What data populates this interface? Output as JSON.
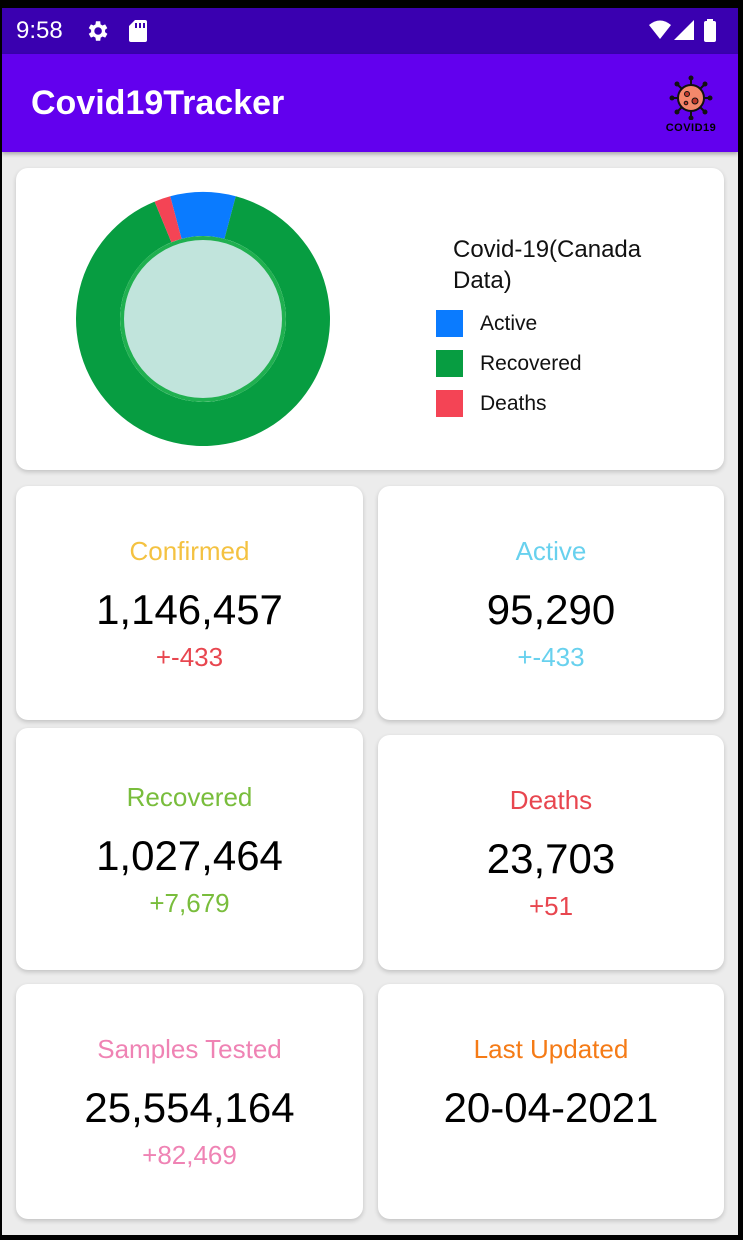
{
  "status": {
    "time": "9:58"
  },
  "appbar": {
    "title": "Covid19Tracker",
    "logo_text": "COVID19"
  },
  "chart_data": {
    "type": "pie",
    "title": "Covid-19(Canada Data)",
    "categories": [
      "Active",
      "Recovered",
      "Deaths"
    ],
    "values": [
      95290,
      1027464,
      23703
    ],
    "colors": [
      "#0a7bff",
      "#079d41",
      "#f44455"
    ],
    "legend": "right"
  },
  "cards": {
    "confirmed": {
      "label": "Confirmed",
      "value": "1,146,457",
      "delta": "+-433",
      "label_color": "#f4c241",
      "delta_color": "#e8464f"
    },
    "active": {
      "label": "Active",
      "value": "95,290",
      "delta": "+-433",
      "label_color": "#68d1ee",
      "delta_color": "#68d1ee"
    },
    "recovered": {
      "label": "Recovered",
      "value": "1,027,464",
      "delta": "+7,679",
      "label_color": "#79bd3c",
      "delta_color": "#79bd3c"
    },
    "deaths": {
      "label": "Deaths",
      "value": "23,703",
      "delta": "+51",
      "label_color": "#e8464f",
      "delta_color": "#e8464f"
    },
    "samples": {
      "label": "Samples Tested",
      "value": "25,554,164",
      "delta": "+82,469",
      "label_color": "#ef83b4",
      "delta_color": "#ef83b4"
    },
    "updated": {
      "label": "Last Updated",
      "value": "20-04-2021",
      "label_color": "#f57b16"
    }
  }
}
